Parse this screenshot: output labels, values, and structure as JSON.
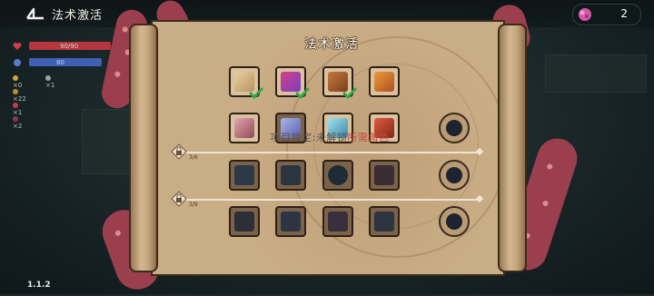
{
  "header": {
    "title": "法术激活",
    "gem_count": "2"
  },
  "panel": {
    "title": "法术激活",
    "tooltip_prefix": "项目锁定:未解锁",
    "tooltip_suffix": "所需角色",
    "rows": [
      {
        "items": [
          "map-scroll-icon",
          "treasure-chest-icon",
          "basket-icon",
          "spell-book-icon"
        ],
        "checked": [
          true,
          true,
          true,
          false
        ]
      },
      {
        "items": [
          "pink-backpack-icon",
          "crystal-blob-icon",
          "ice-crystal-icon",
          "red-rune-book-icon"
        ],
        "checked": [
          false,
          false,
          false,
          false
        ]
      },
      {
        "items": [
          "dark-armor-icon",
          "dark-gear-icon",
          "dark-orb-icon",
          "dark-cloak-icon"
        ],
        "checked": [
          false,
          false,
          false,
          false
        ]
      },
      {
        "items": [
          "dark-shard-icon",
          "dark-staff-icon",
          "dark-gem-icon",
          "dark-star-icon"
        ],
        "checked": [
          false,
          false,
          false,
          false
        ]
      }
    ],
    "locks": [
      {
        "count": "3/6"
      },
      {
        "count": "3/9"
      }
    ]
  },
  "hud": {
    "hp": "90/90",
    "mp": "80",
    "stats": [
      "×0",
      "×1",
      "×22",
      "×1",
      "×2"
    ]
  },
  "version": "1.1.2",
  "colors": {
    "parchment": "#c9ad85",
    "tentacle": "#9b3f4f",
    "check": "#2fa84a",
    "hp_bar": "#b5363d",
    "mp_bar": "#3f5fb5"
  }
}
